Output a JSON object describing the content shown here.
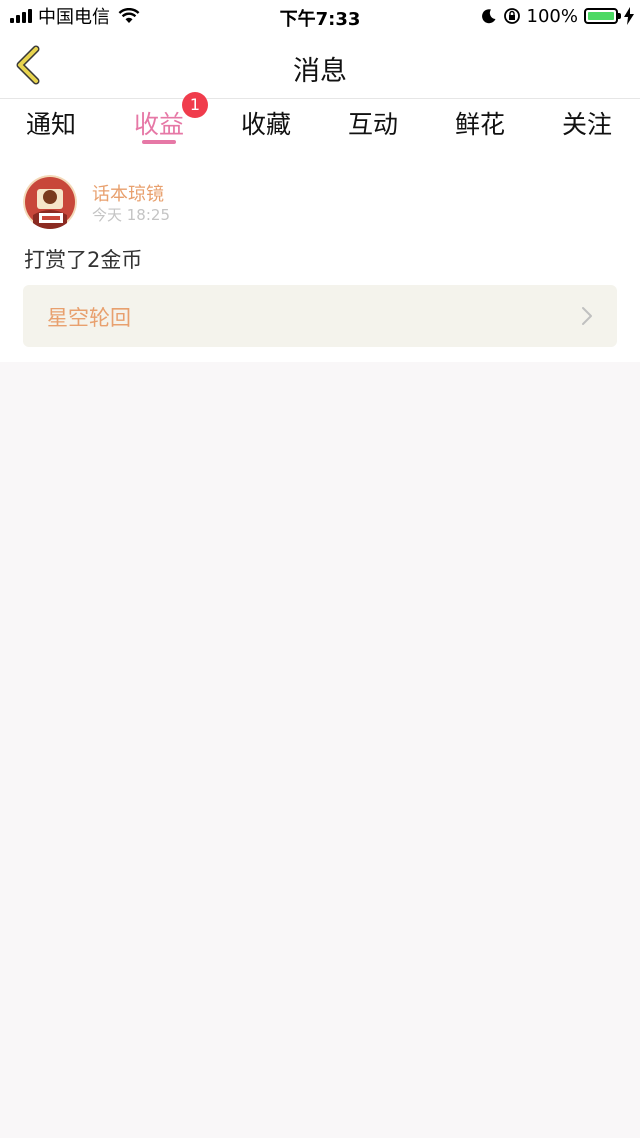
{
  "status_bar": {
    "carrier": "中国电信",
    "time": "下午7:33",
    "battery": "100%",
    "signal_icon": "signal-bars",
    "wifi_icon": "wifi",
    "moon_icon": "do-not-disturb",
    "lock_icon": "rotation-lock",
    "charging_icon": "bolt"
  },
  "nav": {
    "title": "消息",
    "back_icon": "chevron-left"
  },
  "tabs": [
    {
      "label": "通知"
    },
    {
      "label": "收益",
      "active": true,
      "badge": "1"
    },
    {
      "label": "收藏"
    },
    {
      "label": "互动"
    },
    {
      "label": "鲜花"
    },
    {
      "label": "关注"
    }
  ],
  "items": [
    {
      "username": "话本琼镜",
      "time": "今天 18:25",
      "message": "打赏了2金币",
      "book_title": "星空轮回",
      "avatar_icon": "user-avatar"
    }
  ],
  "colors": {
    "accent": "#e678a6",
    "username": "#e8a06e",
    "badge": "#f03c4c",
    "book_bg": "#f4f3ec",
    "back_icon": "#e8d44e"
  }
}
